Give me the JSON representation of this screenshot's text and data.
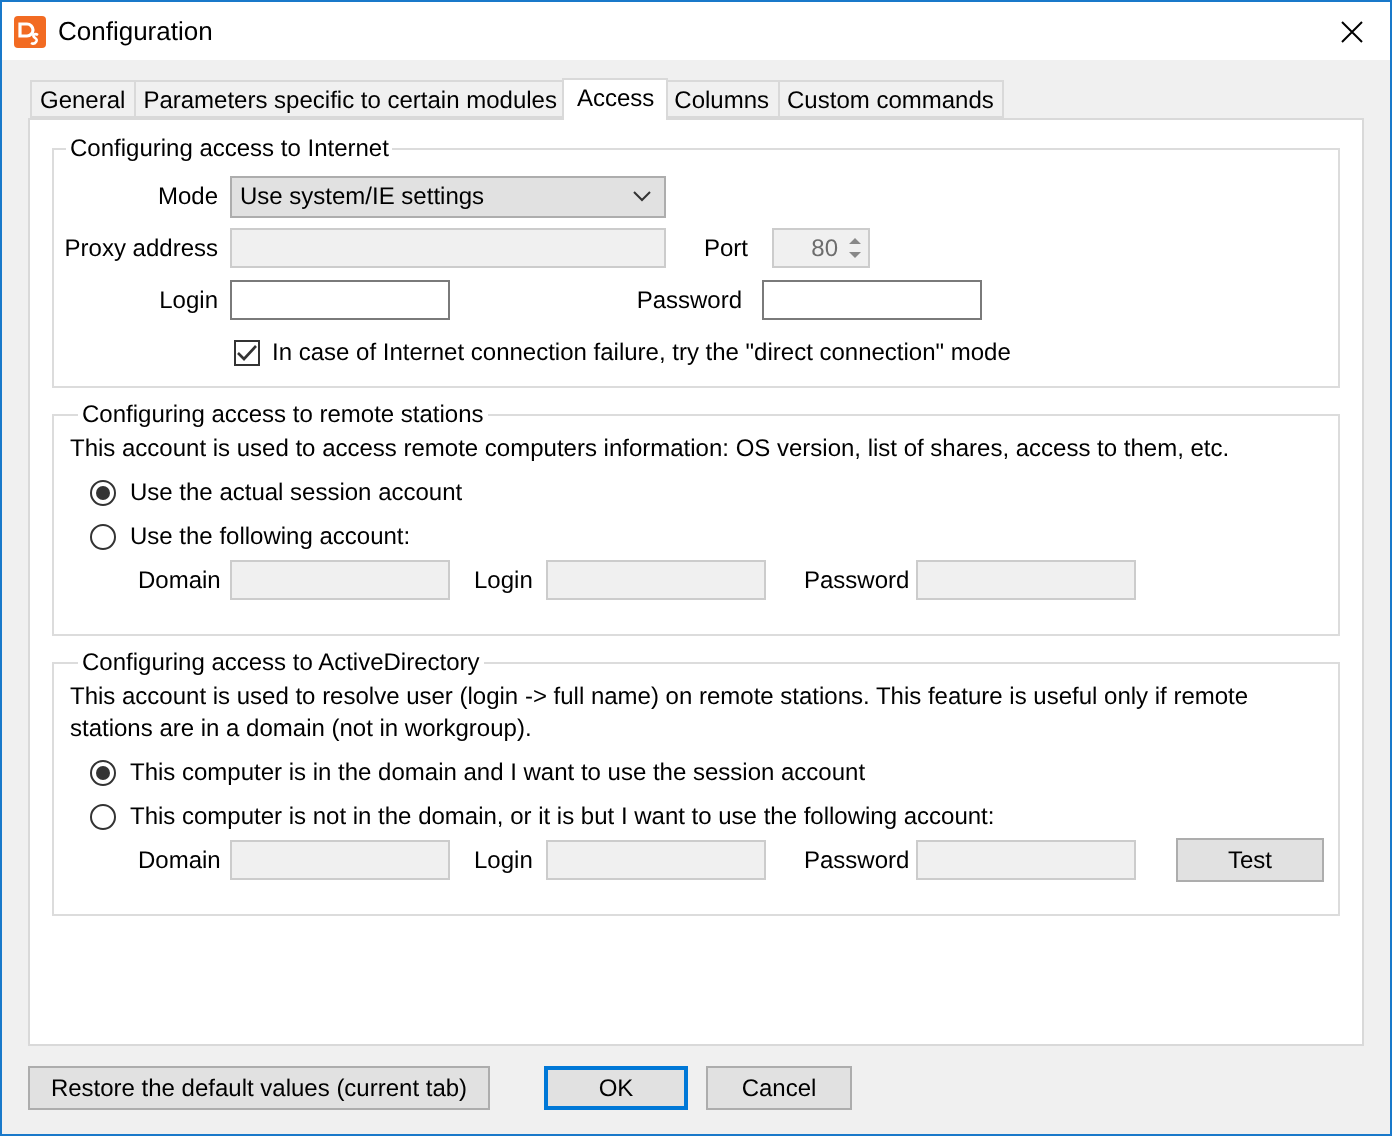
{
  "window": {
    "title": "Configuration"
  },
  "tabs": [
    {
      "label": "General",
      "selected": false
    },
    {
      "label": "Parameters specific to certain modules",
      "selected": false
    },
    {
      "label": "Access",
      "selected": true
    },
    {
      "label": "Columns",
      "selected": false
    },
    {
      "label": "Custom commands",
      "selected": false
    }
  ],
  "internet": {
    "title": "Configuring access to Internet",
    "mode_label": "Mode",
    "mode_value": "Use system/IE settings",
    "proxy_label": "Proxy address",
    "proxy_disabled": true,
    "port_label": "Port",
    "port_value": "80",
    "port_disabled": true,
    "login_label": "Login",
    "login_disabled": false,
    "password_label": "Password",
    "password_disabled": false,
    "direct_mode": {
      "label": "In case of Internet connection failure, try the \"direct connection\" mode",
      "checked": true
    }
  },
  "remote": {
    "title": "Configuring access to remote stations",
    "description": "This account is used to access remote computers information: OS version, list of shares, access to them, etc.",
    "options": [
      {
        "label": "Use the actual session account",
        "selected": true
      },
      {
        "label": "Use the following account:",
        "selected": false
      }
    ],
    "fields": [
      {
        "label": "Domain",
        "disabled": true
      },
      {
        "label": "Login",
        "disabled": true
      },
      {
        "label": "Password",
        "disabled": true
      }
    ]
  },
  "active_directory": {
    "title": "Configuring access to ActiveDirectory",
    "description": "This account is used to resolve user (login -> full name) on remote stations. This feature is useful only if remote stations are in a domain (not in workgroup).",
    "options": [
      {
        "label": "This computer is in the domain and I want to use the session account",
        "selected": true
      },
      {
        "label": "This computer is not in the domain, or it is but I want to use the following account:",
        "selected": false
      }
    ],
    "fields": [
      {
        "label": "Domain",
        "disabled": true
      },
      {
        "label": "Login",
        "disabled": true
      },
      {
        "label": "Password",
        "disabled": true
      }
    ],
    "test_button": "Test"
  },
  "buttons": [
    {
      "label": "Restore the default values (current tab)",
      "default": false
    },
    {
      "label": "OK",
      "default": true
    },
    {
      "label": "Cancel",
      "default": false
    }
  ]
}
